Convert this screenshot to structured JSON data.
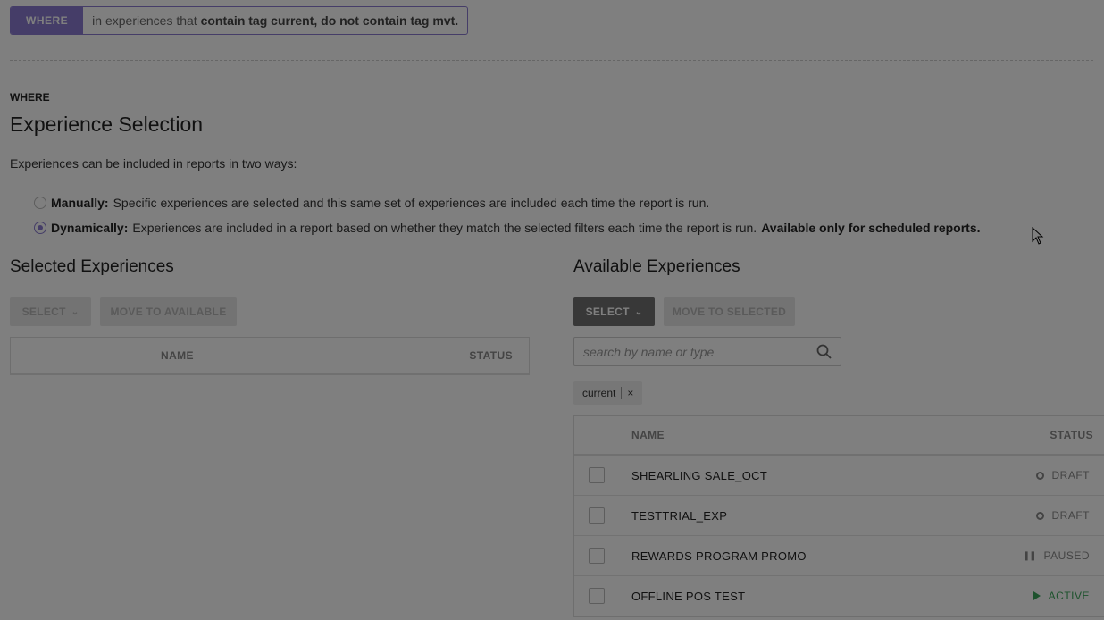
{
  "filter_bar": {
    "tag": "WHERE",
    "prefix": "in experiences that",
    "condition": "contain tag current, do not contain tag mvt."
  },
  "section": {
    "label": "WHERE",
    "title": "Experience Selection",
    "intro": "Experiences can be included in reports in two ways:"
  },
  "options": {
    "manual": {
      "label": "Manually:",
      "text": "Specific experiences are selected and this same set of experiences are included each time the report is run.",
      "checked": false
    },
    "dynamic": {
      "label": "Dynamically:",
      "text": "Experiences are included in a report based on whether they match the selected filters each time the report is run.",
      "note": "Available only for scheduled reports.",
      "checked": true
    }
  },
  "selected": {
    "title": "Selected Experiences",
    "select_label": "SELECT",
    "move_label": "MOVE TO AVAILABLE",
    "col_name": "NAME",
    "col_status": "STATUS"
  },
  "available": {
    "title": "Available Experiences",
    "select_label": "SELECT",
    "move_label": "MOVE TO SELECTED",
    "search_placeholder": "search by name or type",
    "chip": "current",
    "chip_remove": "×",
    "col_name": "NAME",
    "col_status": "STATUS",
    "rows": [
      {
        "name": "SHEARLING SALE_OCT",
        "status": "DRAFT"
      },
      {
        "name": "TESTTRIAL_EXP",
        "status": "DRAFT"
      },
      {
        "name": "REWARDS PROGRAM PROMO",
        "status": "PAUSED"
      },
      {
        "name": "OFFLINE POS TEST",
        "status": "ACTIVE"
      }
    ]
  },
  "colors": {
    "accent": "#8a7bd0",
    "active": "#3aa55a",
    "overlay": "rgba(0,0,0,0.5)"
  }
}
